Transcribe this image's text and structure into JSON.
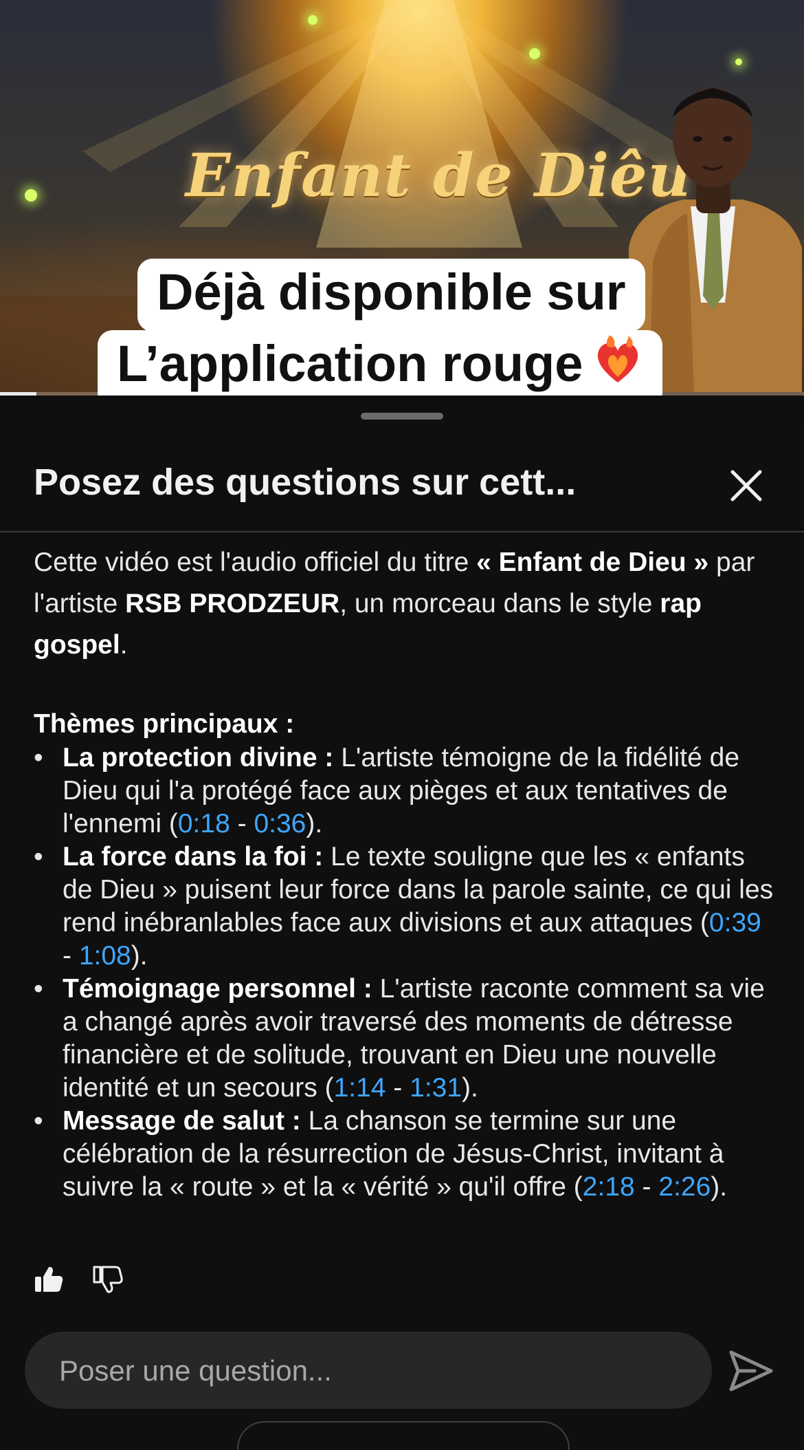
{
  "video": {
    "title_art": "Enfant de Diêu",
    "caption_line1": "Déjà disponible sur",
    "caption_line2": "L’application rouge",
    "progress_fraction": 0.045
  },
  "panel": {
    "title": "Posez des questions sur cett...",
    "intro": {
      "t1": "Cette vidéo est l'audio officiel du titre ",
      "b1": "« Enfant de Dieu »",
      "t2": " par l'artiste ",
      "b2": "RSB PRODZEUR",
      "t3": ", un morceau dans le style ",
      "b3": "rap gospel",
      "t4": "."
    },
    "themes_heading": "Thèmes principaux :",
    "themes": [
      {
        "label": "La protection divine :",
        "text": " L'artiste témoigne de la fidélité de Dieu qui l'a protégé face aux pièges et aux tentatives de l'ennemi (",
        "start": "0:18",
        "end": "0:36"
      },
      {
        "label": "La force dans la foi :",
        "text": " Le texte souligne que les « enfants de Dieu » puisent leur force dans la parole sainte, ce qui les rend inébranlables face aux divisions et aux attaques (",
        "start": "0:39",
        "end": "1:08"
      },
      {
        "label": "Témoignage personnel :",
        "text": " L'artiste raconte comment sa vie a changé après avoir traversé des moments de détresse financière et de solitude, trouvant en Dieu une nouvelle identité et un secours (",
        "start": "1:14",
        "end": "1:31"
      },
      {
        "label": "Message de salut :",
        "text": " La chanson se termine sur une célébration de la résurrection de Jésus-Christ, invitant à suivre la « route » et la « vérité » qu'il offre (",
        "start": "2:18",
        "end": "2:26"
      }
    ],
    "sep": " - ",
    "close_paren": ").",
    "ask_placeholder": "Poser une question..."
  },
  "colors": {
    "accent_link": "#3ea6ff",
    "sheet_bg": "#0f0f0f",
    "input_bg": "#272727"
  },
  "icons": [
    "close-icon",
    "thumbs-up-icon",
    "thumbs-down-icon",
    "send-icon",
    "fire-heart-icon"
  ]
}
